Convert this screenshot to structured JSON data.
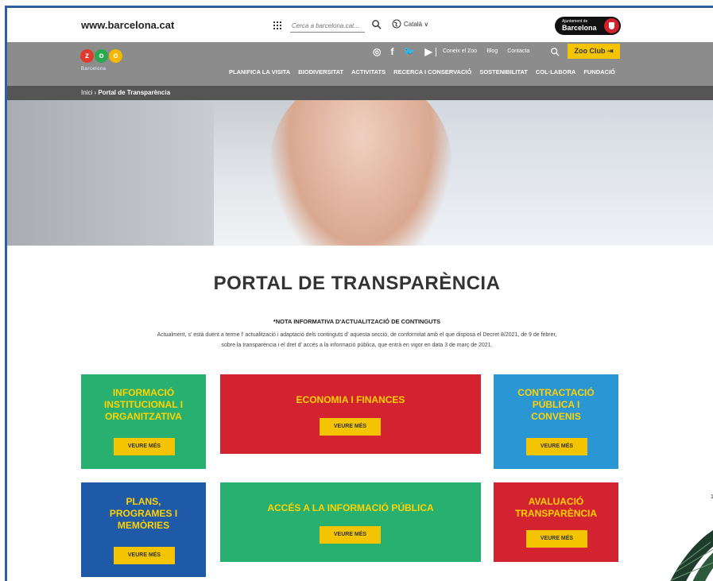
{
  "topbar": {
    "site_url": "www.barcelona.cat",
    "search_placeholder": "Cerca a barcelona.cat...",
    "language": "Català ∨",
    "ajuntament_small": "Ajuntament de",
    "ajuntament_big": "Barcelona"
  },
  "header": {
    "logo_letters": [
      "z",
      "o",
      "o"
    ],
    "logo_colors": [
      "#e03a2e",
      "#29a84f",
      "#f5b800"
    ],
    "logo_sub": "Barcelona",
    "social_icons": [
      "instagram-icon",
      "facebook-icon",
      "twitter-icon",
      "youtube-icon"
    ],
    "social_glyphs": [
      "◎",
      "f",
      "🐦",
      "▶"
    ],
    "top_links": [
      "Coneix el Zoo",
      "Blog",
      "Contacta"
    ],
    "zoo_club_label": "Zoo Club ⇥",
    "nav_items": [
      "PLANIFICA LA VISITA",
      "BIODIVERSITAT",
      "ACTIVITATS",
      "RECERCA I CONSERVACIÓ",
      "SOSTENIBILITAT",
      "COL·LABORA",
      "FUNDACIÓ"
    ]
  },
  "breadcrumb": {
    "home": "Inici",
    "separator": " › ",
    "current": "Portal de Transparència"
  },
  "main": {
    "title": "PORTAL DE TRANSPARÈNCIA",
    "note_title": "*NOTA INFORMATIVA D'ACTUALITZACIÓ DE CONTINGUTS",
    "note_line1": "Actualment, s' està duent a terme l' actualització i adaptació dels continguts d' aquesta secció, de conformitat amb el que disposa el Decret 8/2021, de 9 de febrer,",
    "note_line2": "sobre la transparència i el dret d' accés a la informació pública, que entrà en vigor en data 3 de març de 2021.",
    "tiles": [
      {
        "title_lines": [
          "INFORMACIÓ",
          "INSTITUCIONAL I",
          "ORGANITZATIVA"
        ],
        "button": "VEURE MÉS",
        "color": "#28b070"
      },
      {
        "title_lines": [
          "ECONOMIA I FINANCES"
        ],
        "button": "VEURE MÉS",
        "color": "#d42330"
      },
      {
        "title_lines": [
          "CONTRACTACIÓ",
          "PÚBLICA I",
          "CONVENIS"
        ],
        "button": "VEURE MÉS",
        "color": "#2a96d4"
      },
      {
        "title_lines": [
          "PLANS,",
          "PROGRAMES I",
          "MEMÒRIES"
        ],
        "button": "VEURE MÉS",
        "color": "#1e5aa8"
      },
      {
        "title_lines": [
          "ACCÉS A LA INFORMACIÓ PÚBLICA"
        ],
        "button": "VEURE MÉS",
        "color": "#28b070"
      },
      {
        "title_lines": [
          "AVALUACIÓ",
          "TRANSPARÈNCIA"
        ],
        "button": "VEURE MÉS",
        "color": "#d42330"
      }
    ]
  },
  "side_mark": "1"
}
